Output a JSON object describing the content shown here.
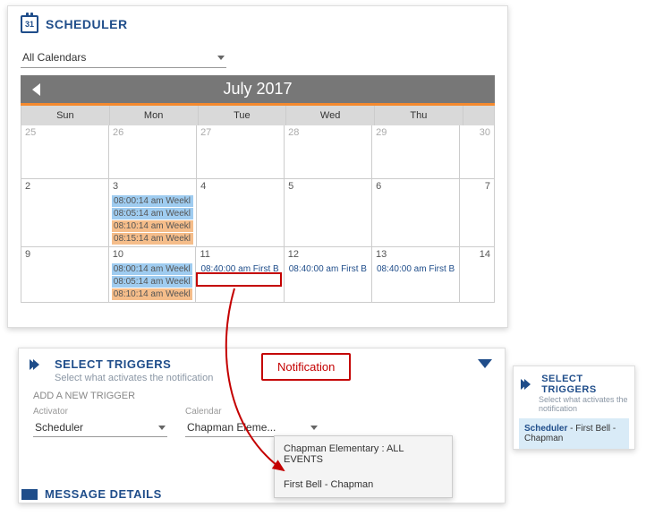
{
  "scheduler": {
    "title": "SCHEDULER",
    "cal_icon_text": "31",
    "calendars_select": "All Calendars",
    "month": "July 2017",
    "dow": [
      "Sun",
      "Mon",
      "Tue",
      "Wed",
      "Thu"
    ],
    "week1": {
      "d0": "25",
      "d1": "26",
      "d2": "27",
      "d3": "28",
      "d4": "29",
      "d5": "30"
    },
    "week2": {
      "d0": "2",
      "d1": "3",
      "d2": "4",
      "d3": "5",
      "d4": "6",
      "d5": "7",
      "d1_ev0": "08:00:14 am Weekl",
      "d1_ev1": "08:05:14 am Weekl",
      "d1_ev2": "08:10:14 am Weekl",
      "d1_ev3": "08:15:14 am Weekl"
    },
    "week3": {
      "d0": "9",
      "d1": "10",
      "d2": "11",
      "d3": "12",
      "d4": "13",
      "d5": "14",
      "d1_ev0": "08:00:14 am Weekl",
      "d1_ev1": "08:05:14 am Weekl",
      "d1_ev2": "08:10:14 am Weekl",
      "d2_ev0": "08:40:00 am First B",
      "d3_ev0": "08:40:00 am First B",
      "d4_ev0": "08:40:00 am First B"
    }
  },
  "triggers": {
    "title": "SELECT TRIGGERS",
    "subtitle": "Select what activates the notification",
    "add_trigger": "ADD A NEW TRIGGER",
    "activator_label": "Activator",
    "activator_value": "Scheduler",
    "calendar_label": "Calendar",
    "calendar_value": "Chapman Eleme...",
    "dropdown0": "Chapman Elementary : ALL EVENTS",
    "dropdown1": "First Bell - Chapman"
  },
  "msg_title": "MESSAGE DETAILS",
  "mini": {
    "title": "SELECT TRIGGERS",
    "subtitle": "Select what activates the notification",
    "scheduler": "Scheduler",
    "rest": " - First Bell - Chapman"
  },
  "anno": "Notification"
}
